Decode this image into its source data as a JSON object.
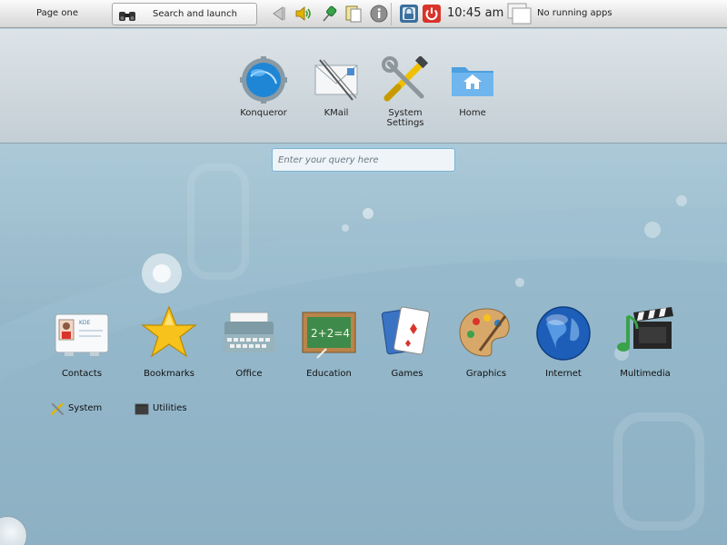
{
  "panel": {
    "page_label": "Page one",
    "search_launch_label": "Search and launch",
    "clock": "10:45 am",
    "taskbar_label": "No running apps"
  },
  "favorites": [
    {
      "label": "Konqueror",
      "icon": "globe-gear-icon"
    },
    {
      "label": "KMail",
      "icon": "mail-icon"
    },
    {
      "label": "System\nSettings",
      "label_line1": "System",
      "label_line2": "Settings",
      "icon": "tools-icon"
    },
    {
      "label": "Home",
      "icon": "home-folder-icon"
    }
  ],
  "query": {
    "placeholder": "Enter your query here",
    "value": ""
  },
  "categories": [
    {
      "label": "Contacts",
      "icon": "address-card-icon"
    },
    {
      "label": "Bookmarks",
      "icon": "star-icon"
    },
    {
      "label": "Office",
      "icon": "typewriter-icon"
    },
    {
      "label": "Education",
      "icon": "chalkboard-icon"
    },
    {
      "label": "Games",
      "icon": "playing-cards-icon"
    },
    {
      "label": "Graphics",
      "icon": "paint-palette-icon"
    },
    {
      "label": "Internet",
      "icon": "globe-icon"
    },
    {
      "label": "Multimedia",
      "icon": "clapperboard-icon"
    }
  ],
  "small_categories": [
    {
      "label": "System",
      "icon": "tools-icon"
    },
    {
      "label": "Utilities",
      "icon": "terminal-icon"
    }
  ],
  "card_text": "KDE",
  "chalkboard_text": "2+2=4",
  "colors": {
    "accent_blue": "#2f7fc1",
    "power_red": "#d9342b",
    "selection_glow": "#9fd0ec"
  }
}
